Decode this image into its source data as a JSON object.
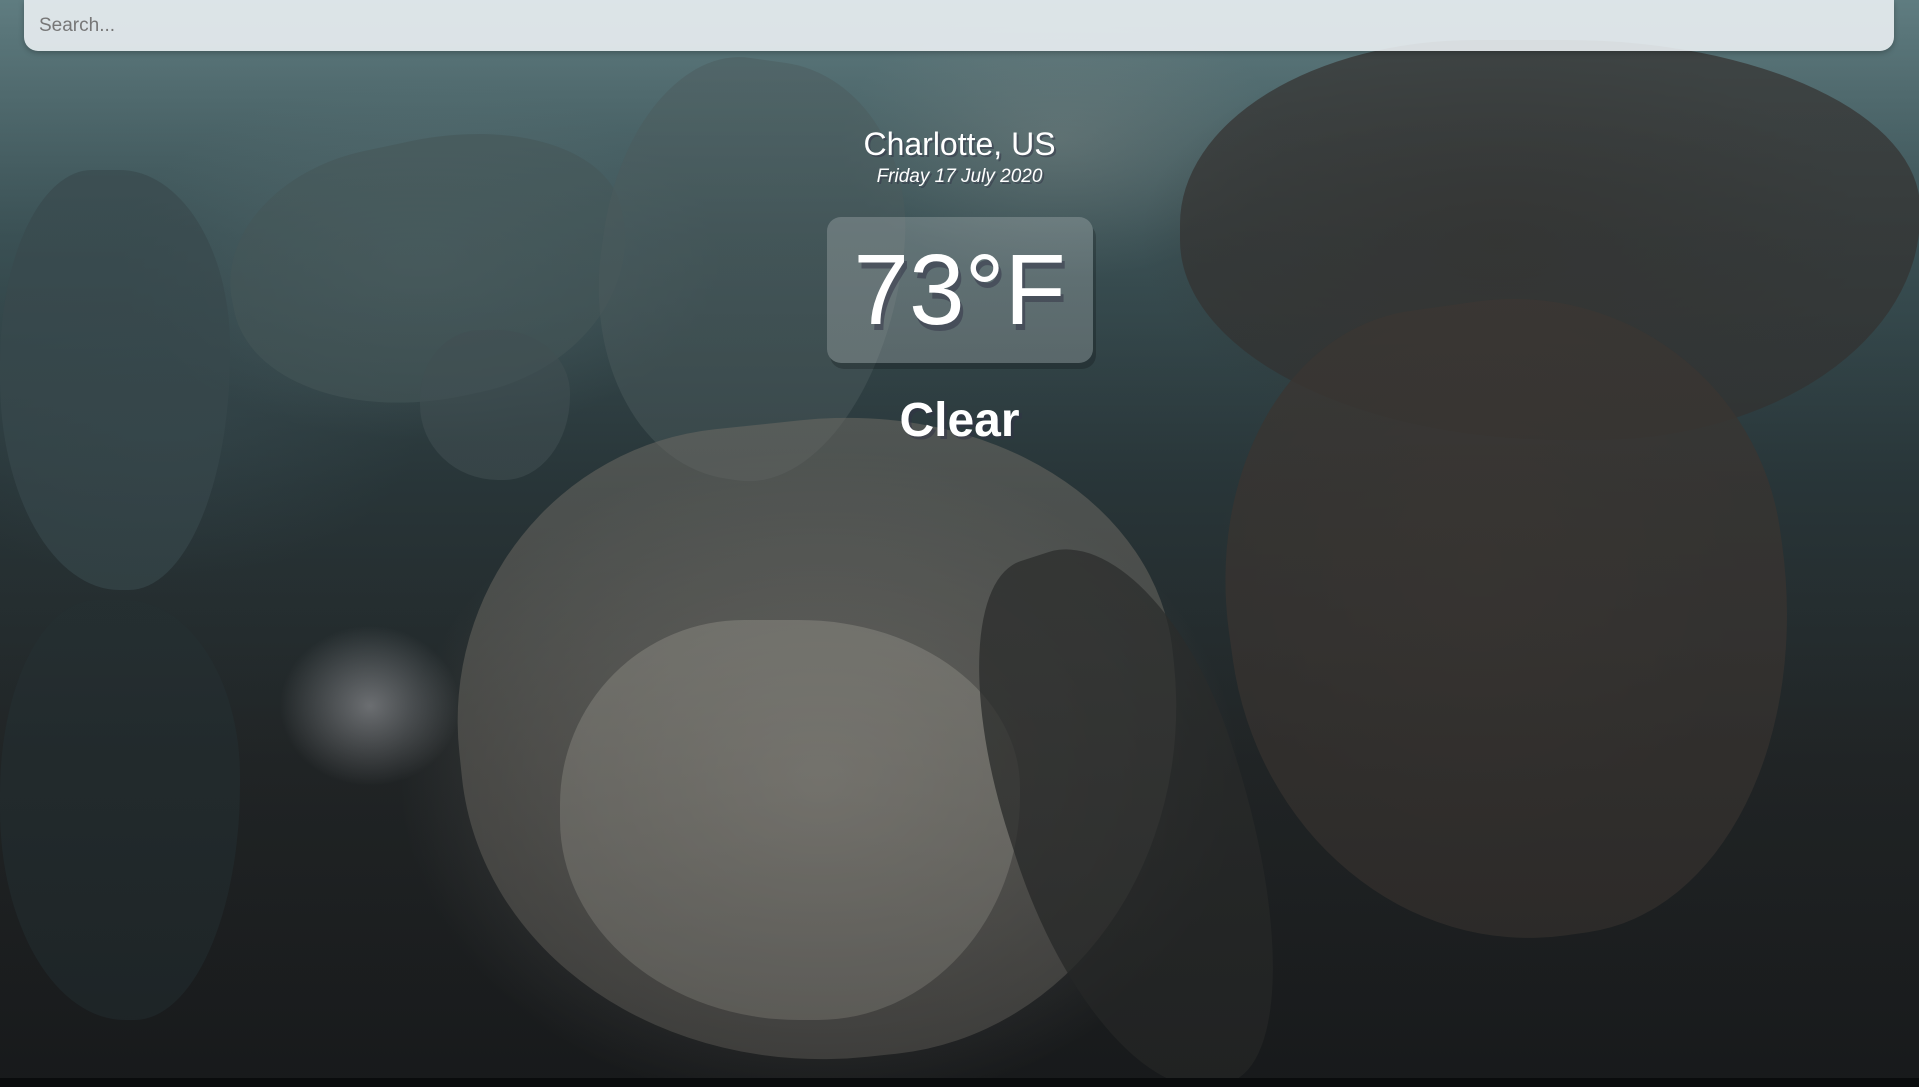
{
  "search": {
    "placeholder": "Search...",
    "value": ""
  },
  "location": {
    "name": "Charlotte, US",
    "date": "Friday 17 July 2020"
  },
  "weather": {
    "temperature": "73°F",
    "condition": "Clear"
  },
  "colors": {
    "text": "#ffffff",
    "search_background": "#eef2f6"
  }
}
